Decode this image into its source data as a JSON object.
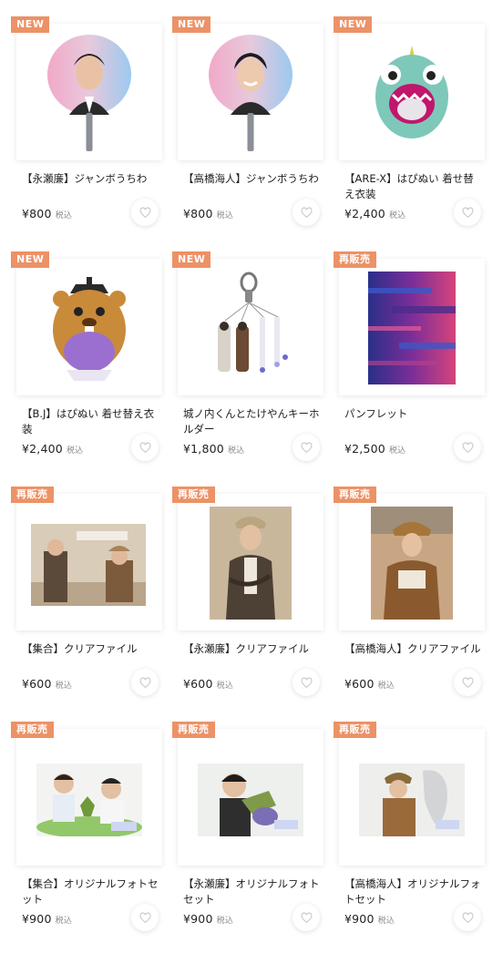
{
  "badge_colors": {
    "new": "#ec9266",
    "restock": "#ec9266"
  },
  "tax_label": "税込",
  "products": [
    {
      "badge": "NEW",
      "name": "【永瀬廉】ジャンボうちわ",
      "price": "¥800",
      "image": "uchiwa-fan-ren"
    },
    {
      "badge": "NEW",
      "name": "【高橋海人】ジャンボうちわ",
      "price": "¥800",
      "image": "uchiwa-fan-kaito"
    },
    {
      "badge": "NEW",
      "name": "【ARE-X】はぴぬい 着せ替え衣装",
      "price": "¥2,400",
      "image": "green-monster-costume"
    },
    {
      "badge": "NEW",
      "name": "【B.J】はぴぬい 着せ替え衣装",
      "price": "¥2,400",
      "image": "hamster-costume"
    },
    {
      "badge": "NEW",
      "name": "城ノ内くんとたけやんキーホルダー",
      "price": "¥1,800",
      "image": "keychain"
    },
    {
      "badge": "再販売",
      "name": "パンフレット",
      "price": "¥2,500",
      "image": "pamphlet"
    },
    {
      "badge": "再販売",
      "name": "【集合】クリアファイル",
      "price": "¥600",
      "image": "clearfile-group"
    },
    {
      "badge": "再販売",
      "name": "【永瀬廉】クリアファイル",
      "price": "¥600",
      "image": "clearfile-ren"
    },
    {
      "badge": "再販売",
      "name": "【高橋海人】クリアファイル",
      "price": "¥600",
      "image": "clearfile-kaito"
    },
    {
      "badge": "再販売",
      "name": "【集合】オリジナルフォトセット",
      "price": "¥900",
      "image": "photoset-group"
    },
    {
      "badge": "再販売",
      "name": "【永瀬廉】オリジナルフォトセット",
      "price": "¥900",
      "image": "photoset-ren"
    },
    {
      "badge": "再販売",
      "name": "【高橋海人】オリジナルフォトセット",
      "price": "¥900",
      "image": "photoset-kaito"
    }
  ]
}
